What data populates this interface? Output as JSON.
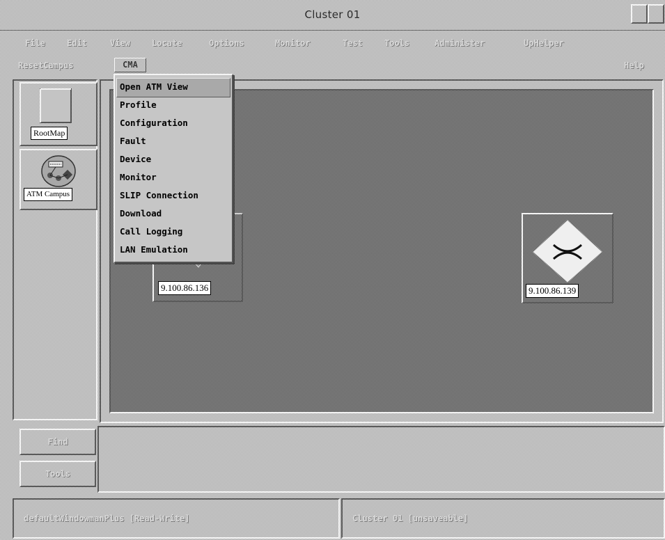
{
  "window": {
    "title": "Cluster 01"
  },
  "menubar": {
    "items": [
      "File",
      "Edit",
      "View",
      "Locate",
      "Options",
      "Monitor",
      "Test",
      "Tools",
      "Administer",
      "UpHelper"
    ]
  },
  "submenubar": {
    "left": "ResetCampus",
    "cma": "CMA",
    "right": "Help"
  },
  "cma_menu": {
    "items": [
      {
        "label": "Open ATM View",
        "active": true
      },
      {
        "label": "Profile"
      },
      {
        "label": "Configuration"
      },
      {
        "label": "Fault"
      },
      {
        "label": "Device"
      },
      {
        "label": "Monitor"
      },
      {
        "label": "SLIP Connection"
      },
      {
        "label": "Download"
      },
      {
        "label": "Call Logging"
      },
      {
        "label": "LAN Emulation"
      }
    ]
  },
  "toolbar": {
    "rootmap_label": "RootMap",
    "atm_campus_label": "ATM Campus"
  },
  "map": {
    "nodes": [
      {
        "ip": "9.100.86.136"
      },
      {
        "ip": "9.100.86.139"
      }
    ]
  },
  "bottom": {
    "button1": "Find",
    "button2": "Tools"
  },
  "status": {
    "left": "defaultWindowmanPlus [Read-Write]",
    "right": "Cluster 01 [unsaveable]"
  },
  "colors": {
    "face": "#bdbdbd",
    "shadow": "#5a5a5a",
    "highlight": "#f4f4f4",
    "label_bg": "#ffffff"
  }
}
